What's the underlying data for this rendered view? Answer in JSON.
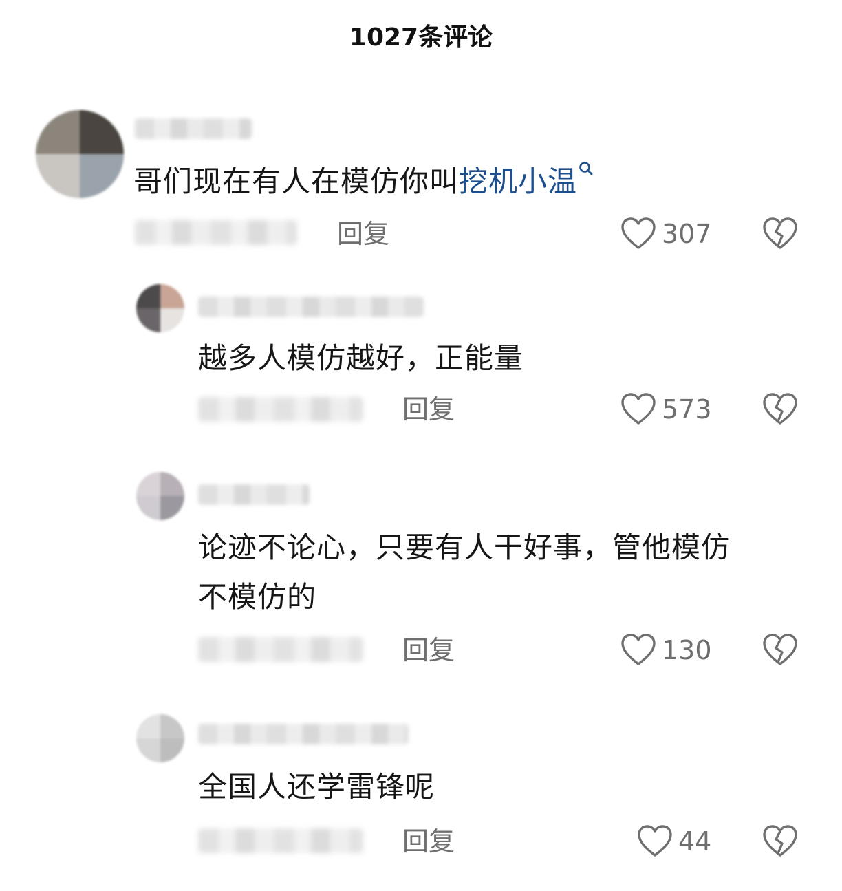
{
  "header": {
    "title": "1027条评论"
  },
  "comments": [
    {
      "text": "哥们现在有人在模仿你叫",
      "link_text": "挖机小温",
      "reply_label": "回复",
      "likes": "307"
    },
    {
      "text": "越多人模仿越好，正能量",
      "reply_label": "回复",
      "likes": "573"
    },
    {
      "text_line1": "论迹不论心，只要有人干好事，管他模仿",
      "text_line2": "不模仿的",
      "reply_label": "回复",
      "likes": "130"
    },
    {
      "text": "全国人还学雷锋呢",
      "reply_label": "回复",
      "likes": "44"
    }
  ],
  "colors": {
    "link": "#1d4f8f",
    "secondary": "#6f6f6f",
    "text": "#161616"
  },
  "icons": [
    "search-icon",
    "heart-icon",
    "broken-heart-icon"
  ]
}
